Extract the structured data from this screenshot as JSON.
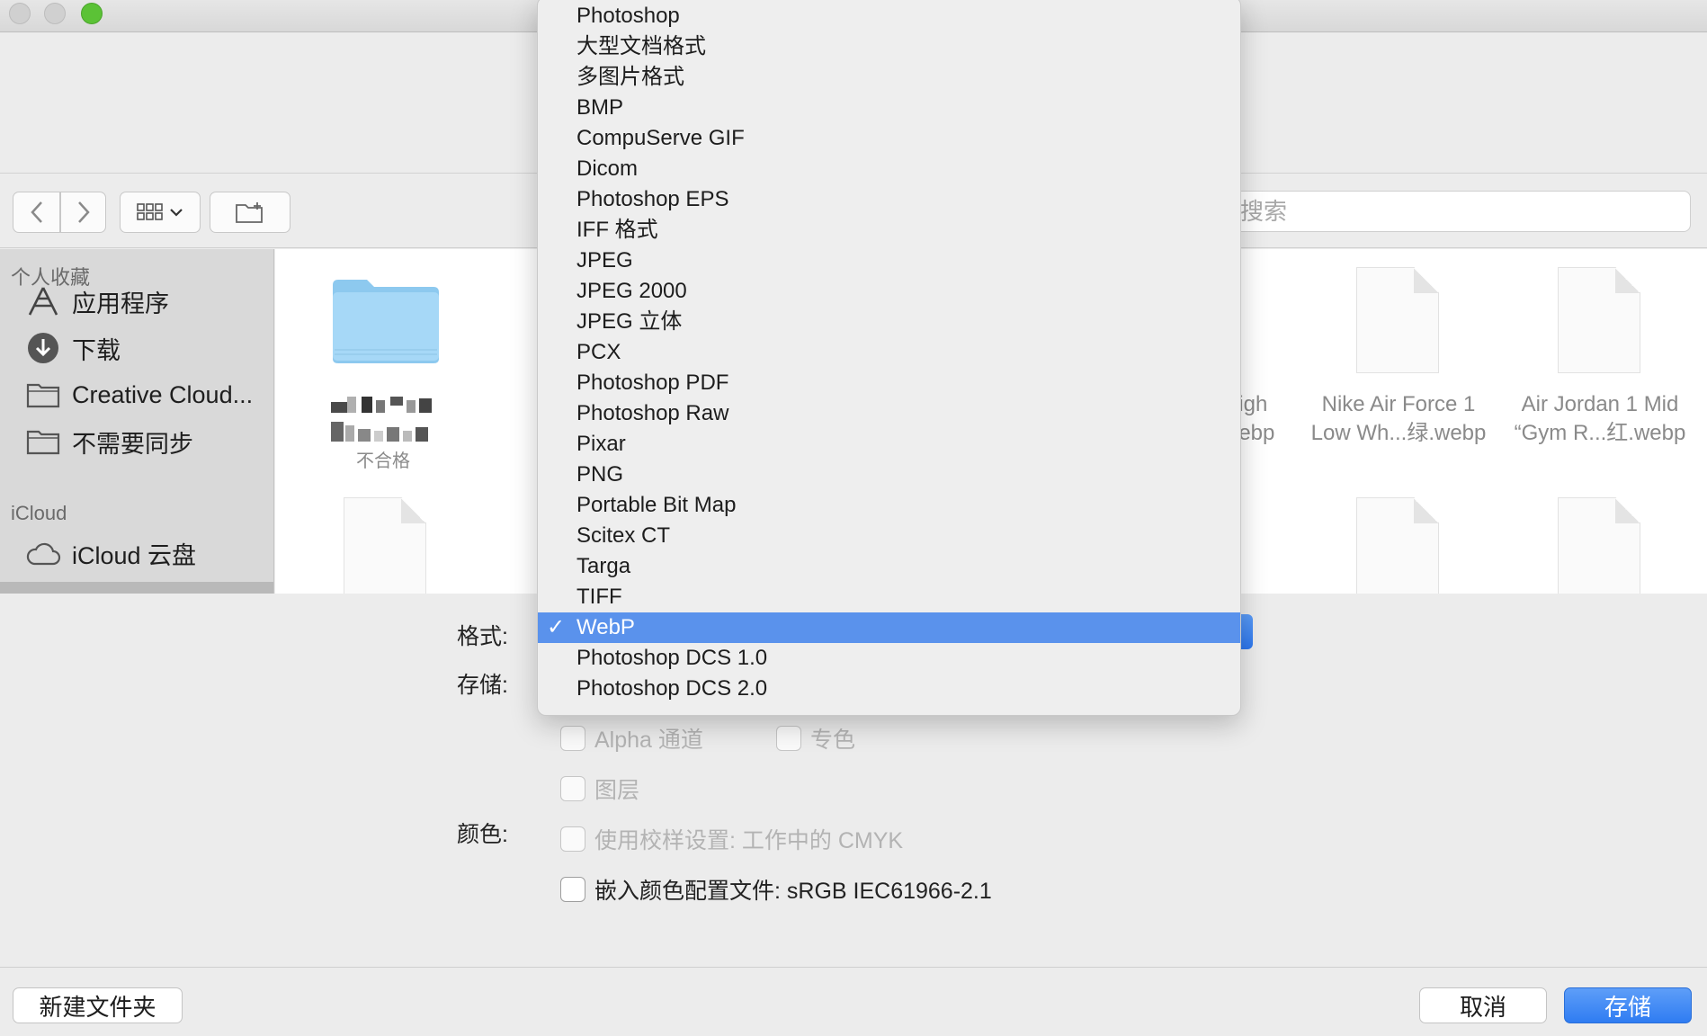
{
  "search": {
    "placeholder": "搜索"
  },
  "sidebar": {
    "favorites_heading": "个人收藏",
    "items": [
      {
        "label": "应用程序",
        "icon": "applications-icon"
      },
      {
        "label": "下载",
        "icon": "download-icon"
      },
      {
        "label": "Creative Cloud...",
        "icon": "folder-icon"
      },
      {
        "label": "不需要同步",
        "icon": "folder-icon"
      }
    ],
    "icloud_heading": "iCloud",
    "icloud_items": [
      {
        "label": "iCloud 云盘",
        "icon": "cloud-icon"
      }
    ]
  },
  "browser": {
    "folder_label": "不合格",
    "files": [
      {
        "line1": "High",
        "line2": "webp"
      },
      {
        "line1": "Nike Air Force 1",
        "line2": "Low Wh...绿.webp"
      },
      {
        "line1": "Air Jordan 1 Mid",
        "line2": "“Gym R...红.webp"
      }
    ]
  },
  "options": {
    "format_label": "格式:",
    "save_label": "存储:",
    "color_label": "颜色:",
    "alpha_label": "Alpha 通道",
    "spot_label": "专色",
    "layers_label": "图层",
    "proof_label": "使用校样设置: 工作中的 CMYK",
    "embed_label": "嵌入颜色配置文件: sRGB IEC61966-2.1"
  },
  "format_menu": {
    "selected": "WebP",
    "items": [
      "Photoshop",
      "大型文档格式",
      "多图片格式",
      "BMP",
      "CompuServe GIF",
      "Dicom",
      "Photoshop EPS",
      "IFF 格式",
      "JPEG",
      "JPEG 2000",
      "JPEG 立体",
      "PCX",
      "Photoshop PDF",
      "Photoshop Raw",
      "Pixar",
      "PNG",
      "Portable Bit Map",
      "Scitex CT",
      "Targa",
      "TIFF",
      "WebP",
      "Photoshop DCS 1.0",
      "Photoshop DCS 2.0"
    ]
  },
  "bottom": {
    "new_folder": "新建文件夹",
    "cancel": "取消",
    "save": "存储"
  },
  "colors": {
    "accent": "#5a92ec",
    "primary_button": "#2f7cf2",
    "close_dot": "#5bc236"
  }
}
